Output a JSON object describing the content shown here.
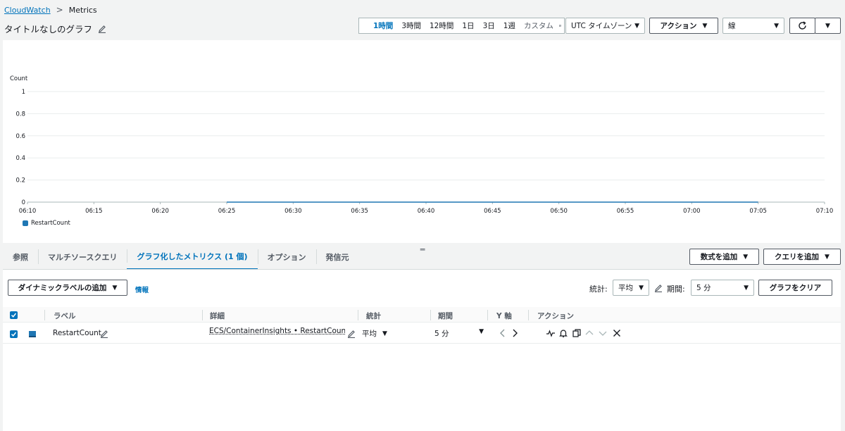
{
  "breadcrumb": {
    "link": "CloudWatch",
    "current": "Metrics"
  },
  "graph_title": "タイトルなしのグラフ",
  "time_ranges": {
    "h1": "1時間",
    "h3": "3時間",
    "h12": "12時間",
    "d1": "1日",
    "d3": "3日",
    "w1": "1週",
    "custom": "カスタム"
  },
  "toolbar": {
    "timezone": "UTC タイムゾーン",
    "actions": "アクション",
    "graph_type": "線"
  },
  "chart_data": {
    "type": "line",
    "ylabel": "Count",
    "ylim": [
      0,
      1
    ],
    "y_ticks": [
      "0",
      "0.2",
      "0.4",
      "0.6",
      "0.8",
      "1"
    ],
    "x_ticks": [
      "06:10",
      "06:15",
      "06:20",
      "06:25",
      "06:30",
      "06:35",
      "06:40",
      "06:45",
      "06:50",
      "06:55",
      "07:00",
      "07:05",
      "07:10"
    ],
    "grid": true,
    "series": [
      {
        "name": "RestartCount",
        "color": "#1f77b4",
        "x": [
          "06:25",
          "07:05"
        ],
        "y": [
          0,
          0
        ]
      }
    ]
  },
  "tabs": {
    "browse": "参照",
    "multi_source": "マルチソースクエリ",
    "graphed": "グラフ化したメトリクス (1 個)",
    "options": "オプション",
    "source": "発信元"
  },
  "right_buttons": {
    "add_math": "数式を追加",
    "add_query": "クエリを追加"
  },
  "controls": {
    "dynamic_label": "ダイナミックラベルの追加",
    "info": "情報",
    "stat_label": "統計:",
    "stat_value": "平均",
    "period_label": "期間:",
    "period_value": "5 分",
    "clear_graph": "グラフをクリア"
  },
  "table": {
    "headers": {
      "label": "ラベル",
      "details": "詳細",
      "stat": "統計",
      "period": "期間",
      "y_axis": "Y 軸",
      "actions": "アクション"
    },
    "rows": [
      {
        "label": "RestartCount",
        "details": "ECS/ContainerInsights • RestartCount • Se",
        "stat": "平均",
        "period": "5 分"
      }
    ]
  }
}
